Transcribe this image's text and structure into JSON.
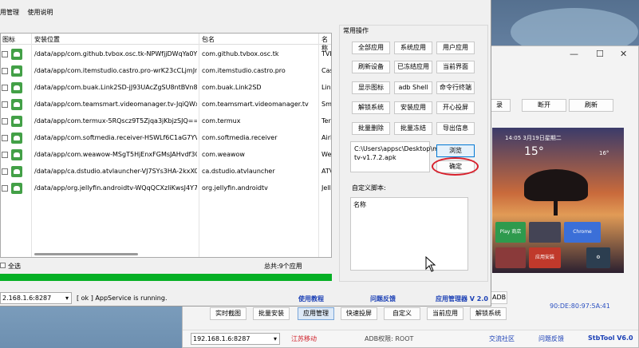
{
  "front": {
    "menu": [
      "用管理",
      "使用说明"
    ],
    "columns": [
      "图标",
      "安装位置",
      "包名",
      "名称"
    ],
    "rows": [
      {
        "path": "/data/app/com.github.tvbox.osc.tk-NPWfjjDWqYa0YB...",
        "pkg": "com.github.tvbox.osc.tk",
        "name": "TVB"
      },
      {
        "path": "/data/app/com.itemstudio.castro.pro-wrK23cCLjmJnE...",
        "pkg": "com.itemstudio.castro.pro",
        "name": "Cast"
      },
      {
        "path": "/data/app/com.buak.Link2SD-jJ93UAcZgSU8ntBVn8Q...",
        "pkg": "com.buak.Link2SD",
        "name": "Link"
      },
      {
        "path": "/data/app/com.teamsmart.videomanager.tv-JqiQWxVJ...",
        "pkg": "com.teamsmart.videomanager.tv",
        "name": "Sma"
      },
      {
        "path": "/data/app/com.termux-5RQscz9T5Zjqa3jKbjzSJQ==/b...",
        "pkg": "com.termux",
        "name": "Ter"
      },
      {
        "path": "/data/app/com.softmedia.receiver-HSWLf6C1aG7YVCf...",
        "pkg": "com.softmedia.receiver",
        "name": "AirF"
      },
      {
        "path": "/data/app/com.weawow-MSgT5HjEnxFGMsJAHvdf3Q...",
        "pkg": "com.weawow",
        "name": "Wea"
      },
      {
        "path": "/data/app/ca.dstudio.atvlauncher-VJ7SYs3HA-2kxXCKf...",
        "pkg": "ca.dstudio.atvlauncher",
        "name": "ATV"
      },
      {
        "path": "/data/app/org.jellyfin.androidtv-WQqQCXzliKwsJ4Y7g...",
        "pkg": "org.jellyfin.androidtv",
        "name": "Jelly"
      }
    ],
    "select_all": "全选",
    "total": "总共:9个应用",
    "progress": 1.0,
    "group_title": "常用操作",
    "buttons": [
      "全部应用",
      "系统应用",
      "用户应用",
      "刷新设备",
      "已冻结应用",
      "当前界面",
      "显示图标",
      "adb Shell",
      "命令行终端",
      "解锁系统",
      "安装应用",
      "开心投屏",
      "批量删除",
      "批量冻结",
      "导出信息"
    ],
    "apk_path": "C:\\Users\\appsc\\Desktop\\my-tv-v1.7.2.apk",
    "browse": "浏览",
    "confirm": "确定",
    "script_label": "自定义脚本:",
    "script_header": "名称",
    "ip": "2.168.1.6:8287",
    "status_msg": "[ ok ] AppService is running.",
    "tutorial": "使用教程",
    "feedback": "问题反馈",
    "version": "应用管理器 V 2.0"
  },
  "back": {
    "btn_a": "录",
    "btn_disconnect": "断开",
    "btn_refresh": "刷新",
    "adb": "ADB",
    "mac": "90:DE:80:97:5A:41",
    "toolbar": [
      "实时截图",
      "批量安装",
      "应用管理",
      "快速投屏",
      "自定义",
      "当前应用",
      "解锁系统"
    ],
    "ip": "192.168.1.6:8287",
    "isp": "江苏移动",
    "adb_perm": "ADB权限: ROOT",
    "community": "交流社区",
    "feedback": "问题反馈",
    "version": "StbTool V6.0",
    "preview": {
      "datetime": "14:05 3月19日星期二",
      "temp": "15°",
      "temp_right": "16°",
      "tiles": [
        "Play 商店",
        "Chrome",
        "应用安装"
      ]
    }
  }
}
